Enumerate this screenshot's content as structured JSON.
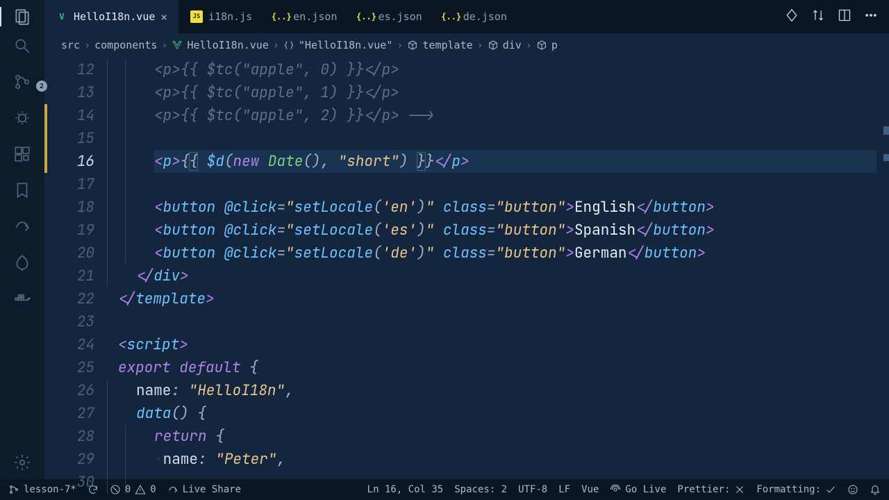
{
  "tabs": [
    {
      "icon": "vue",
      "iconGlyph": "V",
      "label": "HelloI18n.vue",
      "active": true,
      "dirty": false
    },
    {
      "icon": "js",
      "iconGlyph": "JS",
      "label": "i18n.js",
      "active": false,
      "dirty": false
    },
    {
      "icon": "json",
      "iconGlyph": "{..}",
      "label": "en.json",
      "active": false,
      "dirty": false
    },
    {
      "icon": "json",
      "iconGlyph": "{..}",
      "label": "es.json",
      "active": false,
      "dirty": false
    },
    {
      "icon": "json",
      "iconGlyph": "{..}",
      "label": "de.json",
      "active": false,
      "dirty": false
    }
  ],
  "scmBadge": "2",
  "breadcrumbs": [
    {
      "icon": null,
      "label": "src"
    },
    {
      "icon": null,
      "label": "components"
    },
    {
      "icon": "vue",
      "label": "HelloI18n.vue"
    },
    {
      "icon": "braces",
      "label": "\"HelloI18n.vue\""
    },
    {
      "icon": "cube",
      "label": "template"
    },
    {
      "icon": "cube",
      "label": "div"
    },
    {
      "icon": "cube",
      "label": "p"
    }
  ],
  "lines": {
    "start": 12,
    "highlight": 16,
    "modified": [
      14,
      15,
      16
    ],
    "count": 19
  },
  "code": {
    "l12": {
      "tag1": "<p>",
      "mus": "{{ ",
      "func": "$tc",
      "args": "(\"apple\", 0) ",
      "mue": "}}",
      "tag2": "</p>"
    },
    "l13": {
      "tag1": "<p>",
      "mus": "{{ ",
      "func": "$tc",
      "args": "(\"apple\", 1) ",
      "mue": "}}",
      "tag2": "</p>"
    },
    "l14": {
      "tag1": "<p>",
      "mus": "{{ ",
      "func": "$tc",
      "args": "(\"apple\", 2) ",
      "mue": "}}",
      "tag2": "</p>",
      "tail": " -->"
    },
    "l16": {
      "tag1": "<p>",
      "o1": "{",
      "o2": "{",
      "sp": " ",
      "func": "$d",
      "p1": "(",
      "kw": "new",
      "sp2": " ",
      "cls": "Date",
      "p2": "(), ",
      "str": "\"short\"",
      "p3": ") ",
      "c1": "}",
      "c2": "}",
      "tag2": "</p>"
    },
    "l18": {
      "tag": "button",
      "ev": "@click",
      "evval": "setLocale('en')",
      "attr": "class",
      "attrval": "button",
      "text": "English"
    },
    "l19": {
      "tag": "button",
      "ev": "@click",
      "evval": "setLocale('es')",
      "attr": "class",
      "attrval": "button",
      "text": "Spanish"
    },
    "l20": {
      "tag": "button",
      "ev": "@click",
      "evval": "setLocale('de')",
      "attr": "class",
      "attrval": "button",
      "text": "German"
    },
    "l21": "</div>",
    "l22": "</template>",
    "l24": "<script>",
    "l25": {
      "kw1": "export",
      "sp": " ",
      "kw2": "default",
      "brace": " {"
    },
    "l26": {
      "prop": "name",
      "val": "\"HelloI18n\""
    },
    "l27": {
      "func": "data",
      "rest": "() {"
    },
    "l28": {
      "kw": "return",
      "brace": " {"
    },
    "l29": {
      "prop": "name",
      "val": "\"Peter\""
    }
  },
  "status": {
    "branch": "lesson-7*",
    "sync": "",
    "errors": "0",
    "warnings": "0",
    "liveShare": "Live Share",
    "position": "Ln 16, Col 35",
    "spaces": "Spaces: 2",
    "encoding": "UTF-8",
    "eol": "LF",
    "lang": "Vue",
    "goLive": "Go Live",
    "prettier": "Prettier:",
    "formatting": "Formatting:"
  }
}
